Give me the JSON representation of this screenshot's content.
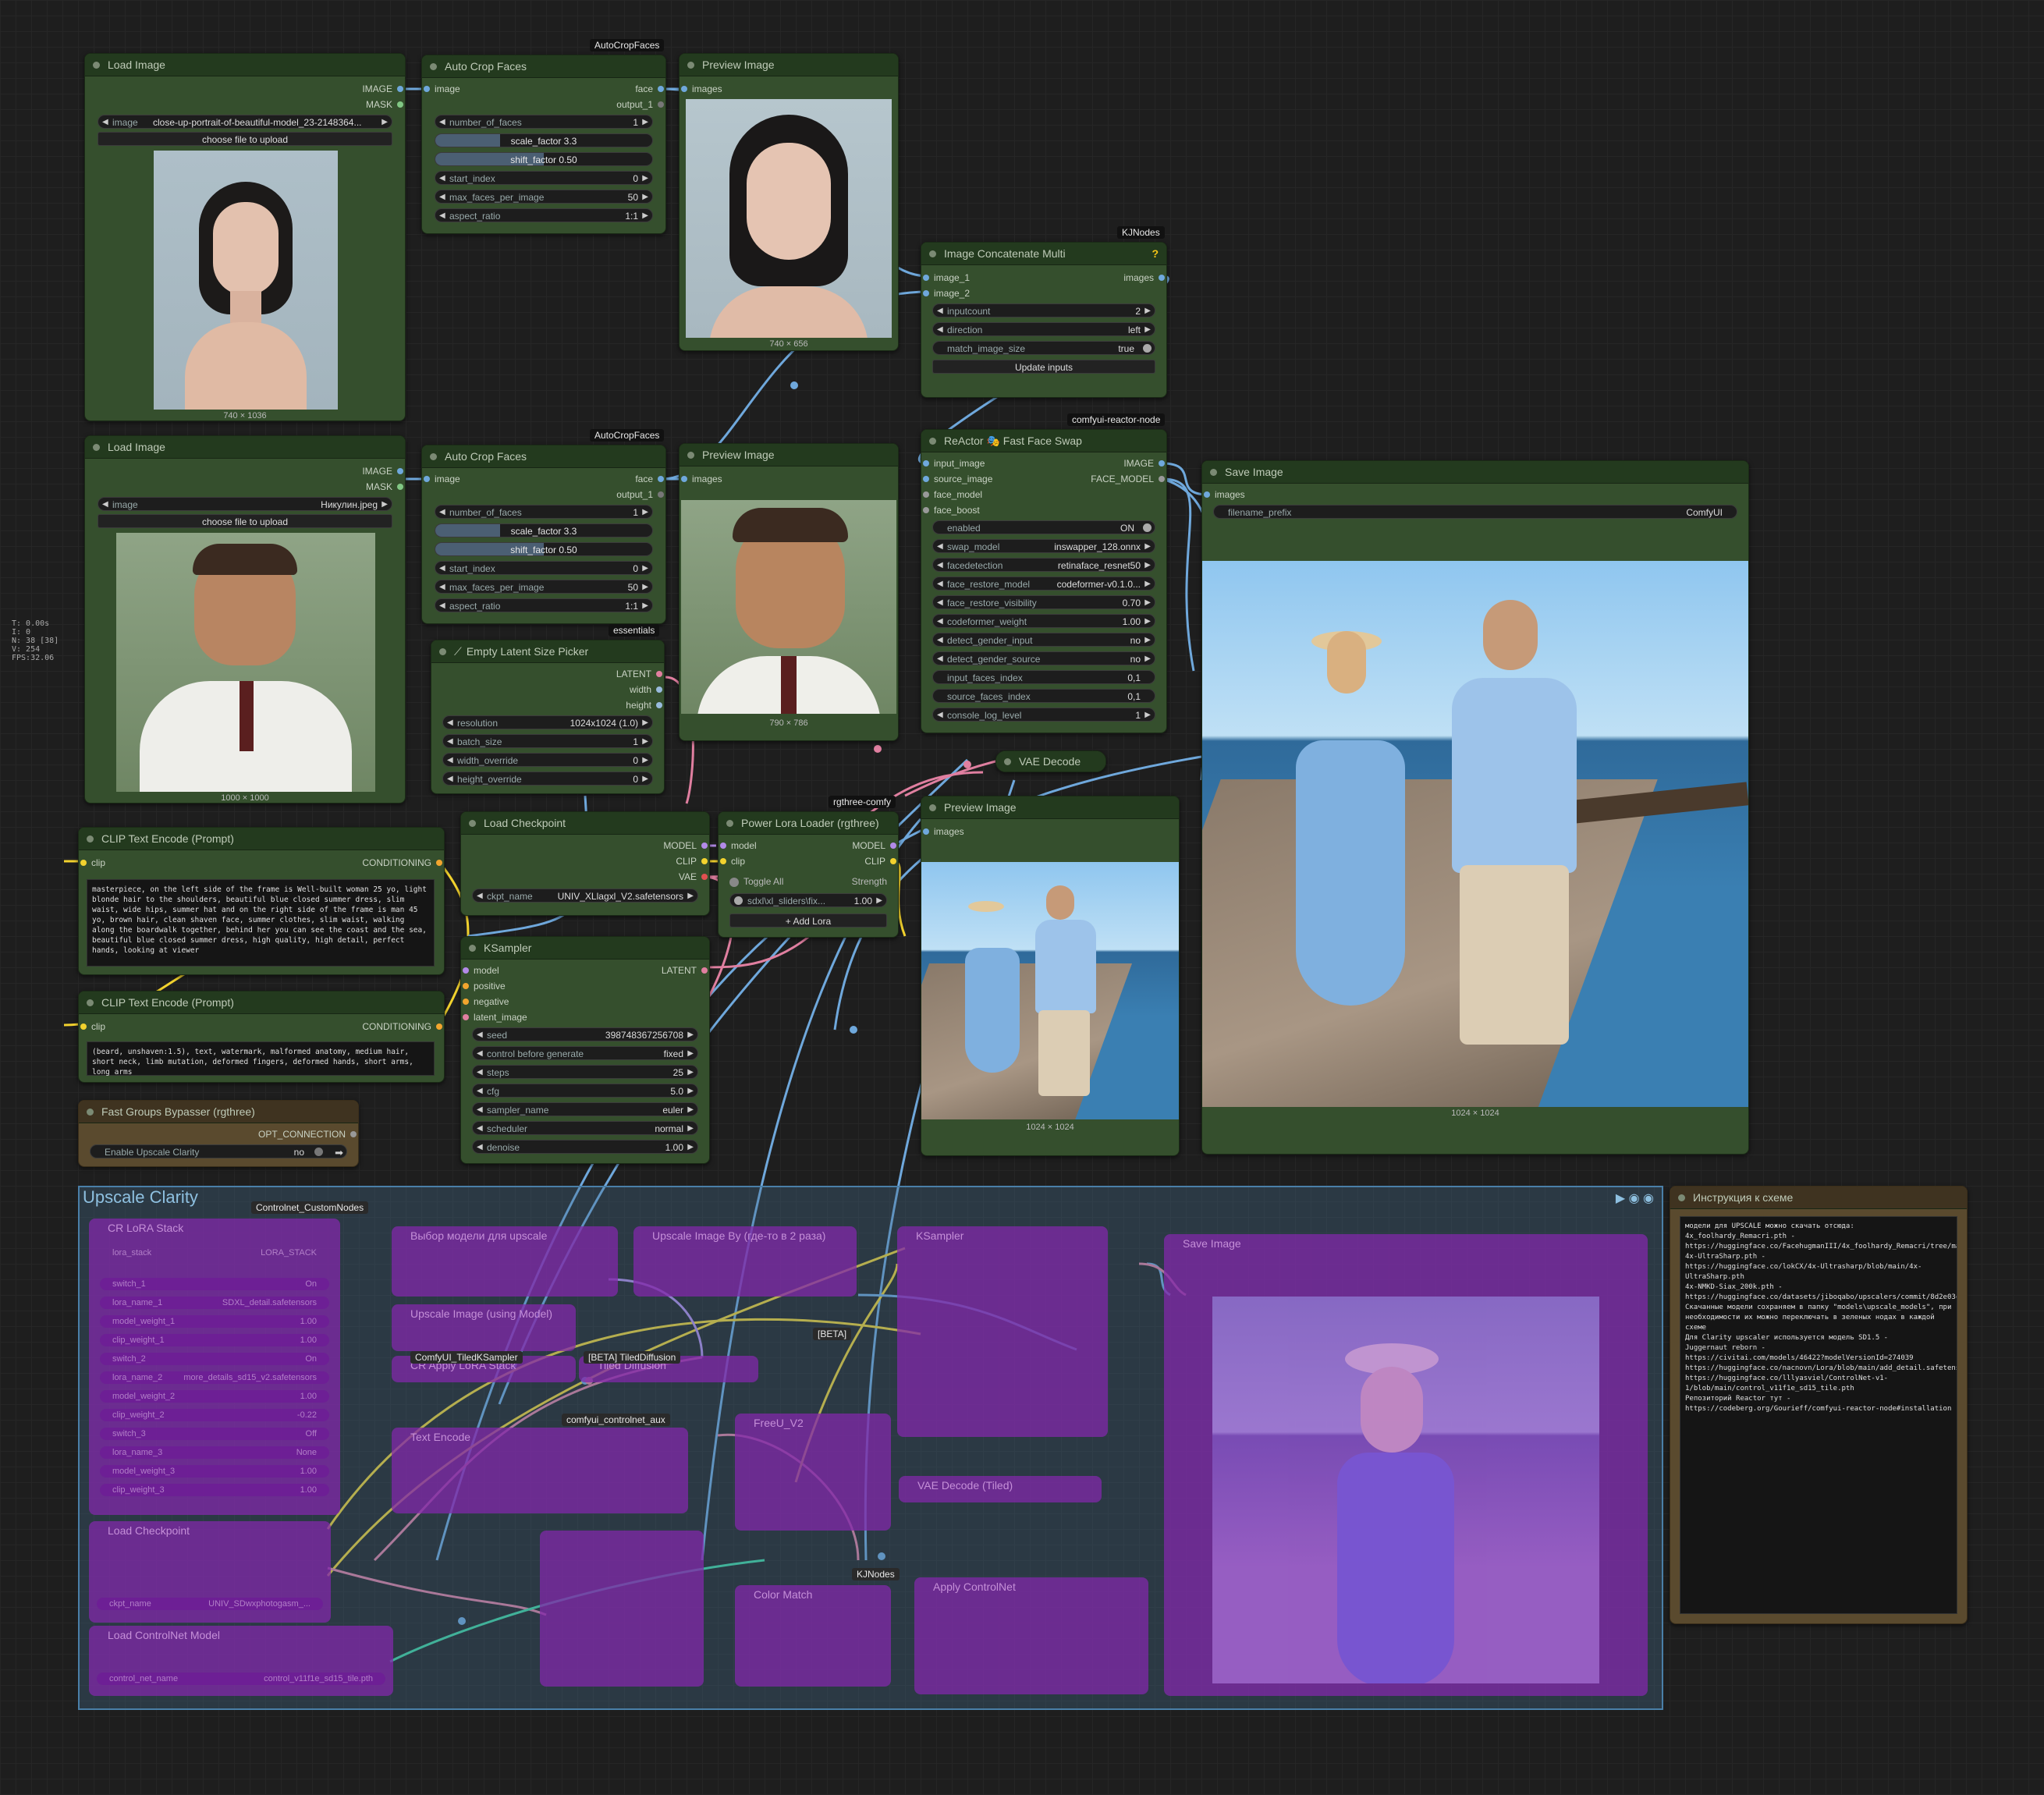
{
  "perf": [
    "T: 0.00s",
    "I: 0",
    "N: 38 [38]",
    "V: 254",
    "FPS:32.06"
  ],
  "nodes": {
    "load1": {
      "title": "Load Image",
      "out_image": "IMAGE",
      "out_mask": "MASK",
      "image_label": "image",
      "image_value": "close-up-portrait-of-beautiful-model_23-2148364...",
      "upload": "choose file to upload",
      "caption": "740 × 1036"
    },
    "crop1": {
      "badge": "AutoCropFaces",
      "title": "Auto Crop Faces",
      "in_image": "image",
      "out_face": "face",
      "out_output": "output_1",
      "w_faces_label": "number_of_faces",
      "w_faces_val": "1",
      "scale_label": "scale_factor",
      "scale_val": "3.3",
      "shift_label": "shift_factor",
      "shift_val": "0.50",
      "start_label": "start_index",
      "start_val": "0",
      "max_label": "max_faces_per_image",
      "max_val": "50",
      "aspect_label": "aspect_ratio",
      "aspect_val": "1:1"
    },
    "prev1": {
      "title": "Preview Image",
      "in_images": "images",
      "caption": "740 × 656"
    },
    "concat": {
      "badge": "KJNodes",
      "title": "Image Concatenate Multi",
      "help": "?",
      "in1": "image_1",
      "in2": "image_2",
      "out": "images",
      "count_label": "inputcount",
      "count_val": "2",
      "dir_label": "direction",
      "dir_val": "left",
      "match_label": "match_image_size",
      "match_val": "true",
      "update": "Update inputs"
    },
    "load2": {
      "title": "Load Image",
      "out_image": "IMAGE",
      "out_mask": "MASK",
      "image_label": "image",
      "image_value": "Никулин.jpeg",
      "upload": "choose file to upload",
      "caption": "1000 × 1000"
    },
    "crop2": {
      "badge": "AutoCropFaces",
      "title": "Auto Crop Faces",
      "in_image": "image",
      "out_face": "face",
      "out_output": "output_1",
      "w_faces_label": "number_of_faces",
      "w_faces_val": "1",
      "scale_label": "scale_factor",
      "scale_val": "3.3",
      "shift_label": "shift_factor",
      "shift_val": "0.50",
      "start_label": "start_index",
      "start_val": "0",
      "max_label": "max_faces_per_image",
      "max_val": "50",
      "aspect_label": "aspect_ratio",
      "aspect_val": "1:1"
    },
    "prev2": {
      "title": "Preview Image",
      "in_images": "images",
      "caption": "790 × 786"
    },
    "reactor": {
      "badge": "comfyui-reactor-node",
      "title": "ReActor 🎭 Fast Face Swap",
      "in_input": "input_image",
      "in_source": "source_image",
      "in_model": "face_model",
      "in_boost": "face_boost",
      "out_image": "IMAGE",
      "out_model": "FACE_MODEL",
      "rows": [
        [
          "enabled",
          "ON"
        ],
        [
          "swap_model",
          "inswapper_128.onnx"
        ],
        [
          "facedetection",
          "retinaface_resnet50"
        ],
        [
          "face_restore_model",
          "codeformer-v0.1.0..."
        ],
        [
          "face_restore_visibility",
          "0.70"
        ],
        [
          "codeformer_weight",
          "1.00"
        ],
        [
          "detect_gender_input",
          "no"
        ],
        [
          "detect_gender_source",
          "no"
        ],
        [
          "input_faces_index",
          "0,1"
        ],
        [
          "source_faces_index",
          "0,1"
        ],
        [
          "console_log_level",
          "1"
        ]
      ]
    },
    "save": {
      "title": "Save Image",
      "in_images": "images",
      "prefix_label": "filename_prefix",
      "prefix_val": "ComfyUI",
      "caption": "1024 × 1024"
    },
    "latent": {
      "badge": "essentials",
      "title": "Empty Latent Size Picker",
      "out_latent": "LATENT",
      "out_width": "width",
      "out_height": "height",
      "rows": [
        [
          "resolution",
          "1024x1024 (1.0)"
        ],
        [
          "batch_size",
          "1"
        ],
        [
          "width_override",
          "0"
        ],
        [
          "height_override",
          "0"
        ]
      ]
    },
    "vae": {
      "title": "VAE Decode"
    },
    "clip1": {
      "title": "CLIP Text Encode (Prompt)",
      "in_clip": "clip",
      "out": "CONDITIONING",
      "text": "masterpiece, on the left side of the frame is Well-built woman 25 yo, light blonde hair to the shoulders, beautiful blue closed summer dress, slim waist, wide hips, summer hat and on the right side of the frame is man 45 yo, brown hair, clean shaven face, summer clothes, slim waist, walking along the boardwalk together, behind her you can see the coast and the sea, beautiful blue closed summer dress, high quality, high detail, perfect hands, looking at viewer"
    },
    "clip2": {
      "title": "CLIP Text Encode (Prompt)",
      "in_clip": "clip",
      "out": "CONDITIONING",
      "text": "(beard, unshaven:1.5), text, watermark, malformed anatomy, medium hair, short neck, limb mutation, deformed fingers, deformed hands, short arms, long arms"
    },
    "ckpt": {
      "title": "Load Checkpoint",
      "out_model": "MODEL",
      "out_clip": "CLIP",
      "out_vae": "VAE",
      "label": "ckpt_name",
      "value": "UNIV_XLlagxl_V2.safetensors"
    },
    "lora": {
      "badge": "rgthree-comfy",
      "title": "Power Lora Loader (rgthree)",
      "in_model": "model",
      "in_clip": "clip",
      "out_model": "MODEL",
      "out_clip": "CLIP",
      "toggle": "Toggle All",
      "strength": "Strength",
      "lora_name": "sdxl\\xl_sliders\\fix...",
      "lora_val": "1.00",
      "add": "+ Add Lora"
    },
    "ksampler": {
      "title": "KSampler",
      "in_model": "model",
      "in_pos": "positive",
      "in_neg": "negative",
      "in_latent": "latent_image",
      "out": "LATENT",
      "rows": [
        [
          "seed",
          "398748367256708"
        ],
        [
          "control before generate",
          "fixed"
        ],
        [
          "steps",
          "25"
        ],
        [
          "cfg",
          "5.0"
        ],
        [
          "sampler_name",
          "euler"
        ],
        [
          "scheduler",
          "normal"
        ],
        [
          "denoise",
          "1.00"
        ]
      ]
    },
    "prev3": {
      "title": "Preview Image",
      "in_images": "images",
      "caption": "1024 × 1024"
    },
    "bypasser": {
      "title": "Fast Groups Bypasser (rgthree)",
      "out": "OPT_CONNECTION",
      "label": "Enable Upscale Clarity",
      "value": "no"
    }
  },
  "group": {
    "title": "Upscale Clarity",
    "sub_badge": "Controlnet_CustomNodes",
    "items": [
      {
        "t": "CR LoRA Stack"
      },
      {
        "t": "Выбор модели для upscale"
      },
      {
        "t": "Upscale Image By (где-то в 2 раза)"
      },
      {
        "t": "KSampler"
      },
      {
        "t": "Save Image"
      },
      {
        "t": "Upscale Image (using Model)"
      },
      {
        "t": "CR Apply LoRA Stack"
      },
      {
        "t": "Tiled Diffusion"
      },
      {
        "t": "Text Encode"
      },
      {
        "t": "FreeU_V2"
      },
      {
        "t": "Load Checkpoint"
      },
      {
        "t": "Load ControlNet Model"
      },
      {
        "t": "VAE Decode (Tiled)"
      },
      {
        "t": "Color Match"
      },
      {
        "t": "Apply ControlNet"
      }
    ],
    "lora_rows": [
      [
        "lora_stack",
        "LORA_STACK"
      ],
      [
        "switch_1",
        "On"
      ],
      [
        "lora_name_1",
        "SDXL_detail.safetensors"
      ],
      [
        "model_weight_1",
        "1.00"
      ],
      [
        "clip_weight_1",
        "1.00"
      ],
      [
        "switch_2",
        "On"
      ],
      [
        "lora_name_2",
        "more_details_sd15_v2.safetensors"
      ],
      [
        "model_weight_2",
        "1.00"
      ],
      [
        "clip_weight_2",
        "-0.22"
      ],
      [
        "switch_3",
        "Off"
      ],
      [
        "lora_name_3",
        "None"
      ],
      [
        "model_weight_3",
        "1.00"
      ],
      [
        "clip_weight_3",
        "1.00"
      ]
    ],
    "ckpt_label": "ckpt_name",
    "ckpt_val": "UNIV_SDwxphotogasm_...",
    "cn_label": "control_net_name",
    "cn_val": "control_v11f1e_sd15_tile.pth",
    "badges": [
      "[BETA] TiledDiffusion",
      "ComfyUI_TiledKSampler",
      "comfyui_controlnet_aux",
      "[BETA]",
      "KJNodes"
    ]
  },
  "instruction": {
    "title": "Инструкция к схеме",
    "text": "модели для UPSCALE можно скачать отсюда:\n4x_foolhardy_Remacri.pth -\nhttps://huggingface.co/FacehugmanIII/4x_foolhardy_Remacri/tree/main\n4x-UltraSharp.pth -\nhttps://huggingface.co/lokCX/4x-Ultrasharp/blob/main/4x-UltraSharp.pth\n4x-NMKD-Siax_200k.pth -\nhttps://huggingface.co/datasets/jiboqabo/upscalers/commit/8d2e03c0\nСкачанные модели сохраняем в папку \"models\\upscale_models\", при\nнеобходимости их можно переключать в зеленых нодах в каждой схеме\nДля Clarity upscaler используется модель SD1.5 -\nJuggernaut reborn -\nhttps://civitai.com/models/46422?modelVersionId=274039\nhttps://huggingface.co/nacnovn/Lora/blob/main/add_detail.safetensors\nhttps://huggingface.co/lllyasviel/ControlNet-v1-1/blob/main/control_v11f1e_sd15_tile.pth\nРепозиторий Reactor тут -\nhttps://codeberg.org/Gourieff/comfyui-reactor-node#installation"
  },
  "colors": {
    "node_bg": "#354f2d",
    "node_title": "#233a1e",
    "group": "#4a7fa8",
    "wire_blue": "#6fa8dc",
    "wire_yellow": "#f2d22e",
    "wire_pink": "#e07fa0",
    "wire_purple": "#b38ae8"
  }
}
